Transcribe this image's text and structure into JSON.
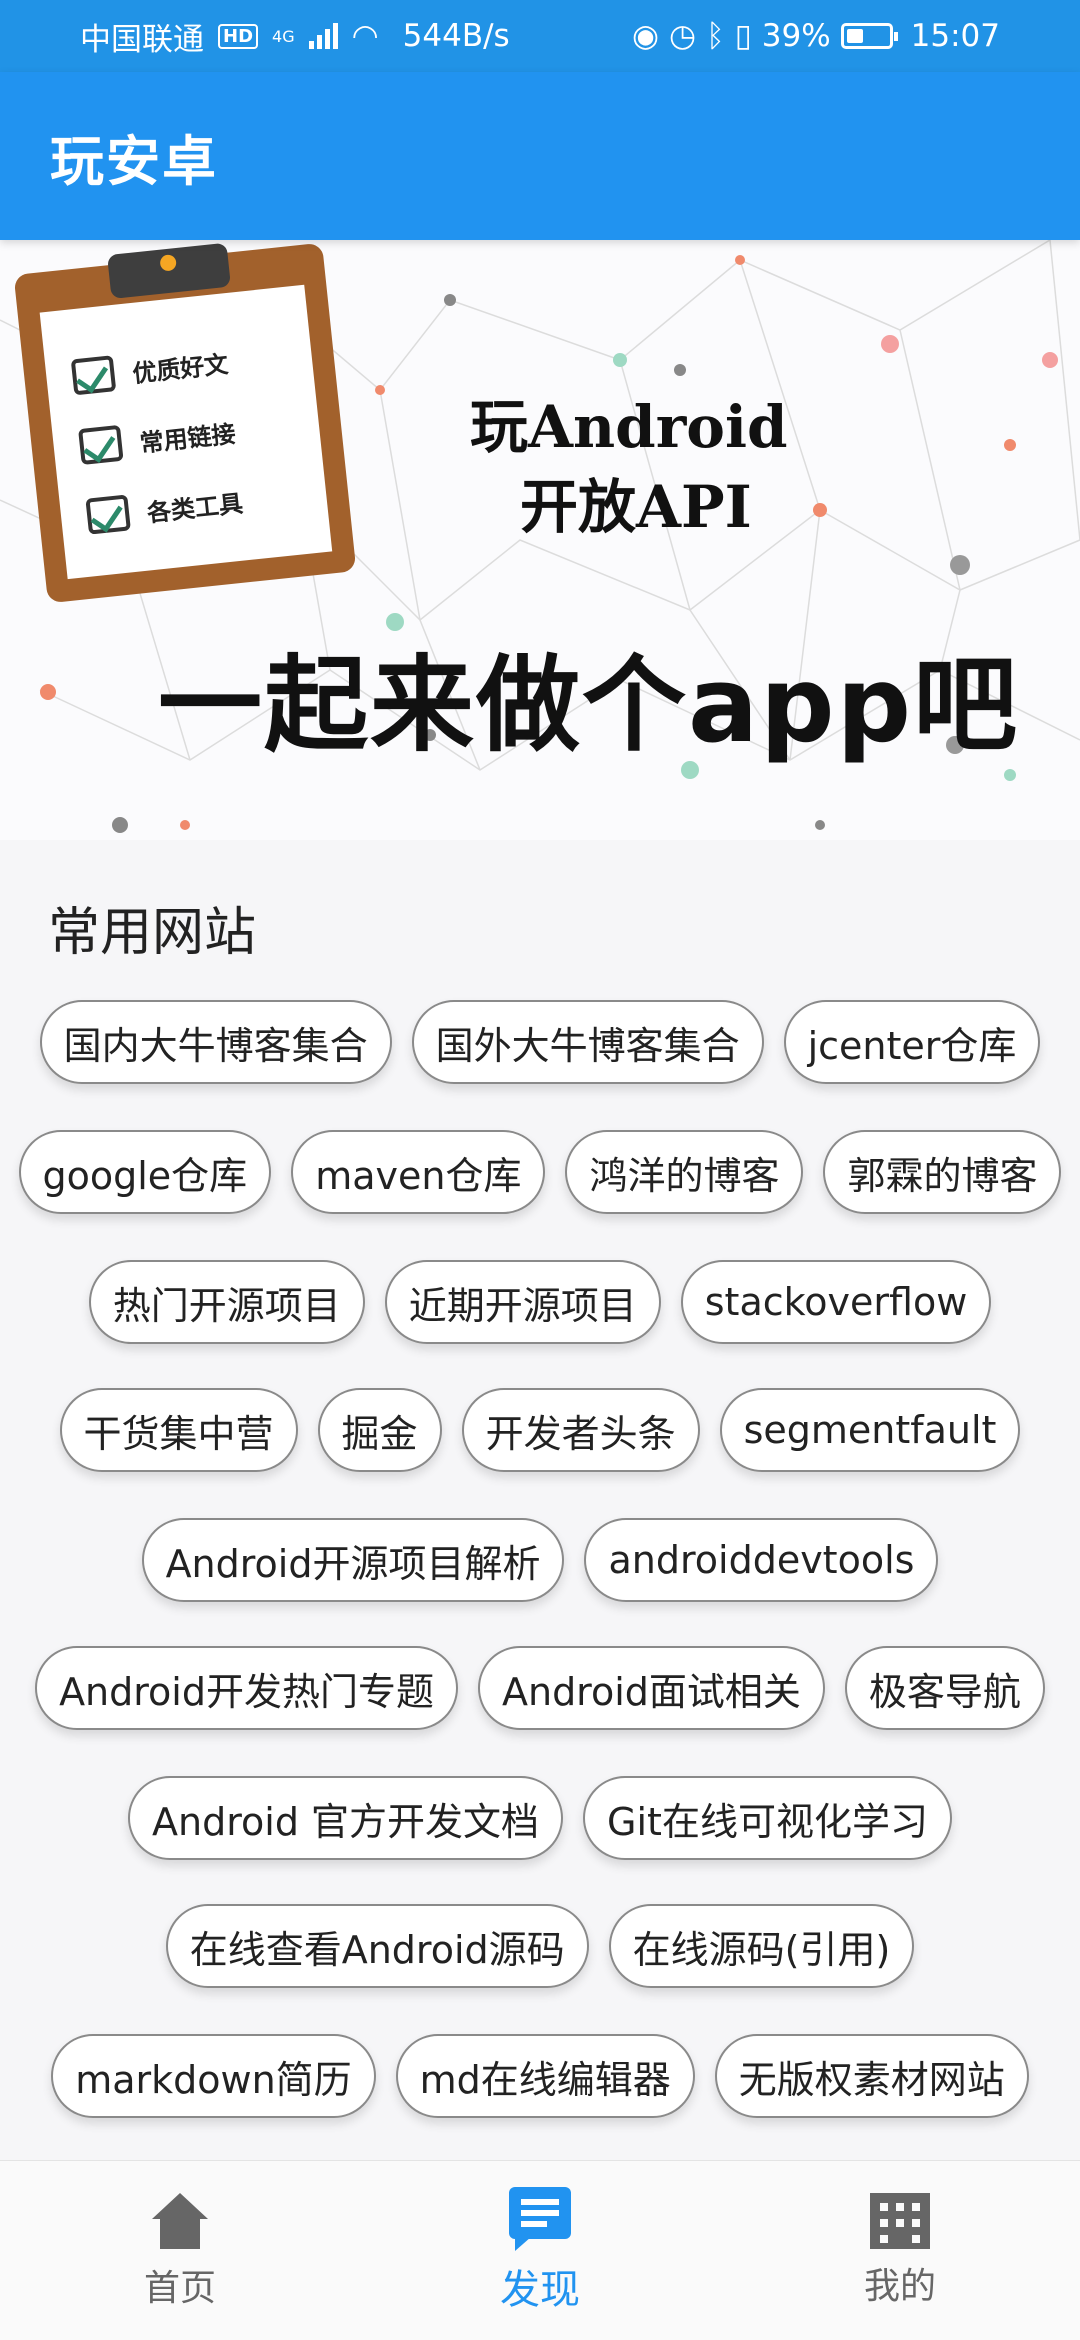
{
  "status_bar": {
    "carrier": "中国联通",
    "hd": "HD",
    "network": "4G",
    "speed": "544B/s",
    "battery": "39%",
    "time": "15:07"
  },
  "app_bar": {
    "title": "玩安卓"
  },
  "banner": {
    "checklist": [
      "优质好文",
      "常用链接",
      "各类工具"
    ],
    "line1": "玩Android",
    "line2": "开放API",
    "slogan": "一起来做个app吧"
  },
  "section": {
    "title": "常用网站"
  },
  "sites": [
    [
      "国内大牛博客集合",
      "国外大牛博客集合",
      "jcenter仓库"
    ],
    [
      "google仓库",
      "maven仓库",
      "鸿洋的博客",
      "郭霖的博客"
    ],
    [
      "热门开源项目",
      "近期开源项目",
      "stackoverflow"
    ],
    [
      "干货集中营",
      "掘金",
      "开发者头条",
      "segmentfault"
    ],
    [
      "Android开源项目解析",
      "androiddevtools"
    ],
    [
      "Android开发热门专题",
      "Android面试相关",
      "极客导航"
    ],
    [
      "Android 官方开发文档",
      "Git在线可视化学习"
    ],
    [
      "在线查看Android源码",
      "在线源码(引用)"
    ],
    [
      "markdown简历",
      "md在线编辑器",
      "无版权素材网站"
    ]
  ],
  "bottom_nav": {
    "items": [
      {
        "label": "首页",
        "icon": "home-icon",
        "active": false
      },
      {
        "label": "发现",
        "icon": "chat-icon",
        "active": true
      },
      {
        "label": "我的",
        "icon": "building-icon",
        "active": false
      }
    ],
    "active_color": "#2193f0"
  },
  "colors": {
    "primary": "#2193f0",
    "status_bar": "#2193e6"
  }
}
